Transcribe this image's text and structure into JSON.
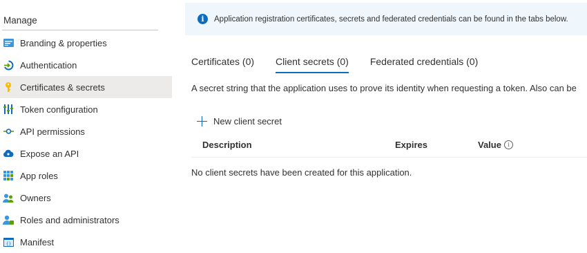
{
  "sidebar": {
    "section_title": "Manage",
    "items": [
      {
        "label": "Branding & properties",
        "icon": "branding-icon"
      },
      {
        "label": "Authentication",
        "icon": "authentication-icon"
      },
      {
        "label": "Certificates & secrets",
        "icon": "key-icon",
        "active": true
      },
      {
        "label": "Token configuration",
        "icon": "token-config-icon"
      },
      {
        "label": "API permissions",
        "icon": "api-permissions-icon"
      },
      {
        "label": "Expose an API",
        "icon": "cloud-icon"
      },
      {
        "label": "App roles",
        "icon": "grid-icon"
      },
      {
        "label": "Owners",
        "icon": "owners-icon"
      },
      {
        "label": "Roles and administrators",
        "icon": "roles-icon"
      },
      {
        "label": "Manifest",
        "icon": "manifest-icon"
      }
    ]
  },
  "banner": {
    "text": "Application registration certificates, secrets and federated credentials can be found in the tabs below.",
    "icon": "info-icon"
  },
  "tabs": [
    {
      "label": "Certificates (0)"
    },
    {
      "label": "Client secrets (0)",
      "active": true
    },
    {
      "label": "Federated credentials (0)"
    }
  ],
  "description": "A secret string that the application uses to prove its identity when requesting a token. Also can be",
  "new_secret_label": "New client secret",
  "table": {
    "headers": {
      "description": "Description",
      "expires": "Expires",
      "value": "Value"
    },
    "empty_message": "No client secrets have been created for this application."
  },
  "colors": {
    "accent": "#0f6cbd",
    "active_bg": "#edebe9",
    "banner_bg": "#eff6fc"
  }
}
